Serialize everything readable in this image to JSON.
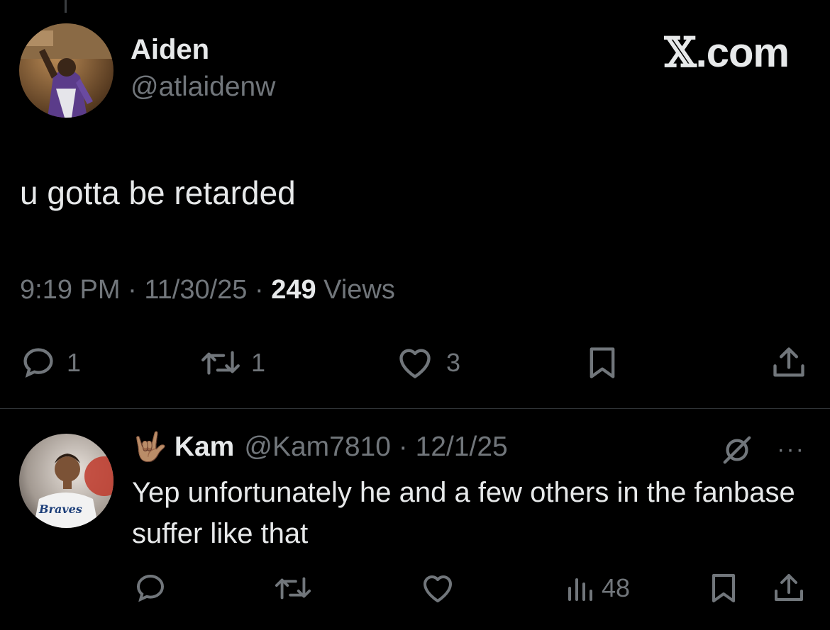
{
  "watermark": "X.com",
  "tweet": {
    "author_name": "Aiden",
    "author_handle": "@atlaidenw",
    "text": "u gotta be retarded",
    "time": "9:19 PM",
    "date": "11/30/25",
    "views_count": "249",
    "views_label": "Views",
    "replies": "1",
    "reposts": "1",
    "likes": "3"
  },
  "reply": {
    "emoji": "🤟🏽",
    "author_name": "Kam",
    "author_handle": "@Kam7810",
    "date": "12/1/25",
    "text": "Yep unfortunately he and a few others in the fanbase suffer like that",
    "views": "48",
    "more": "···"
  },
  "colors": {
    "background": "#000000",
    "text": "#e7e9ea",
    "muted": "#71767b",
    "divider": "#2f3336"
  }
}
